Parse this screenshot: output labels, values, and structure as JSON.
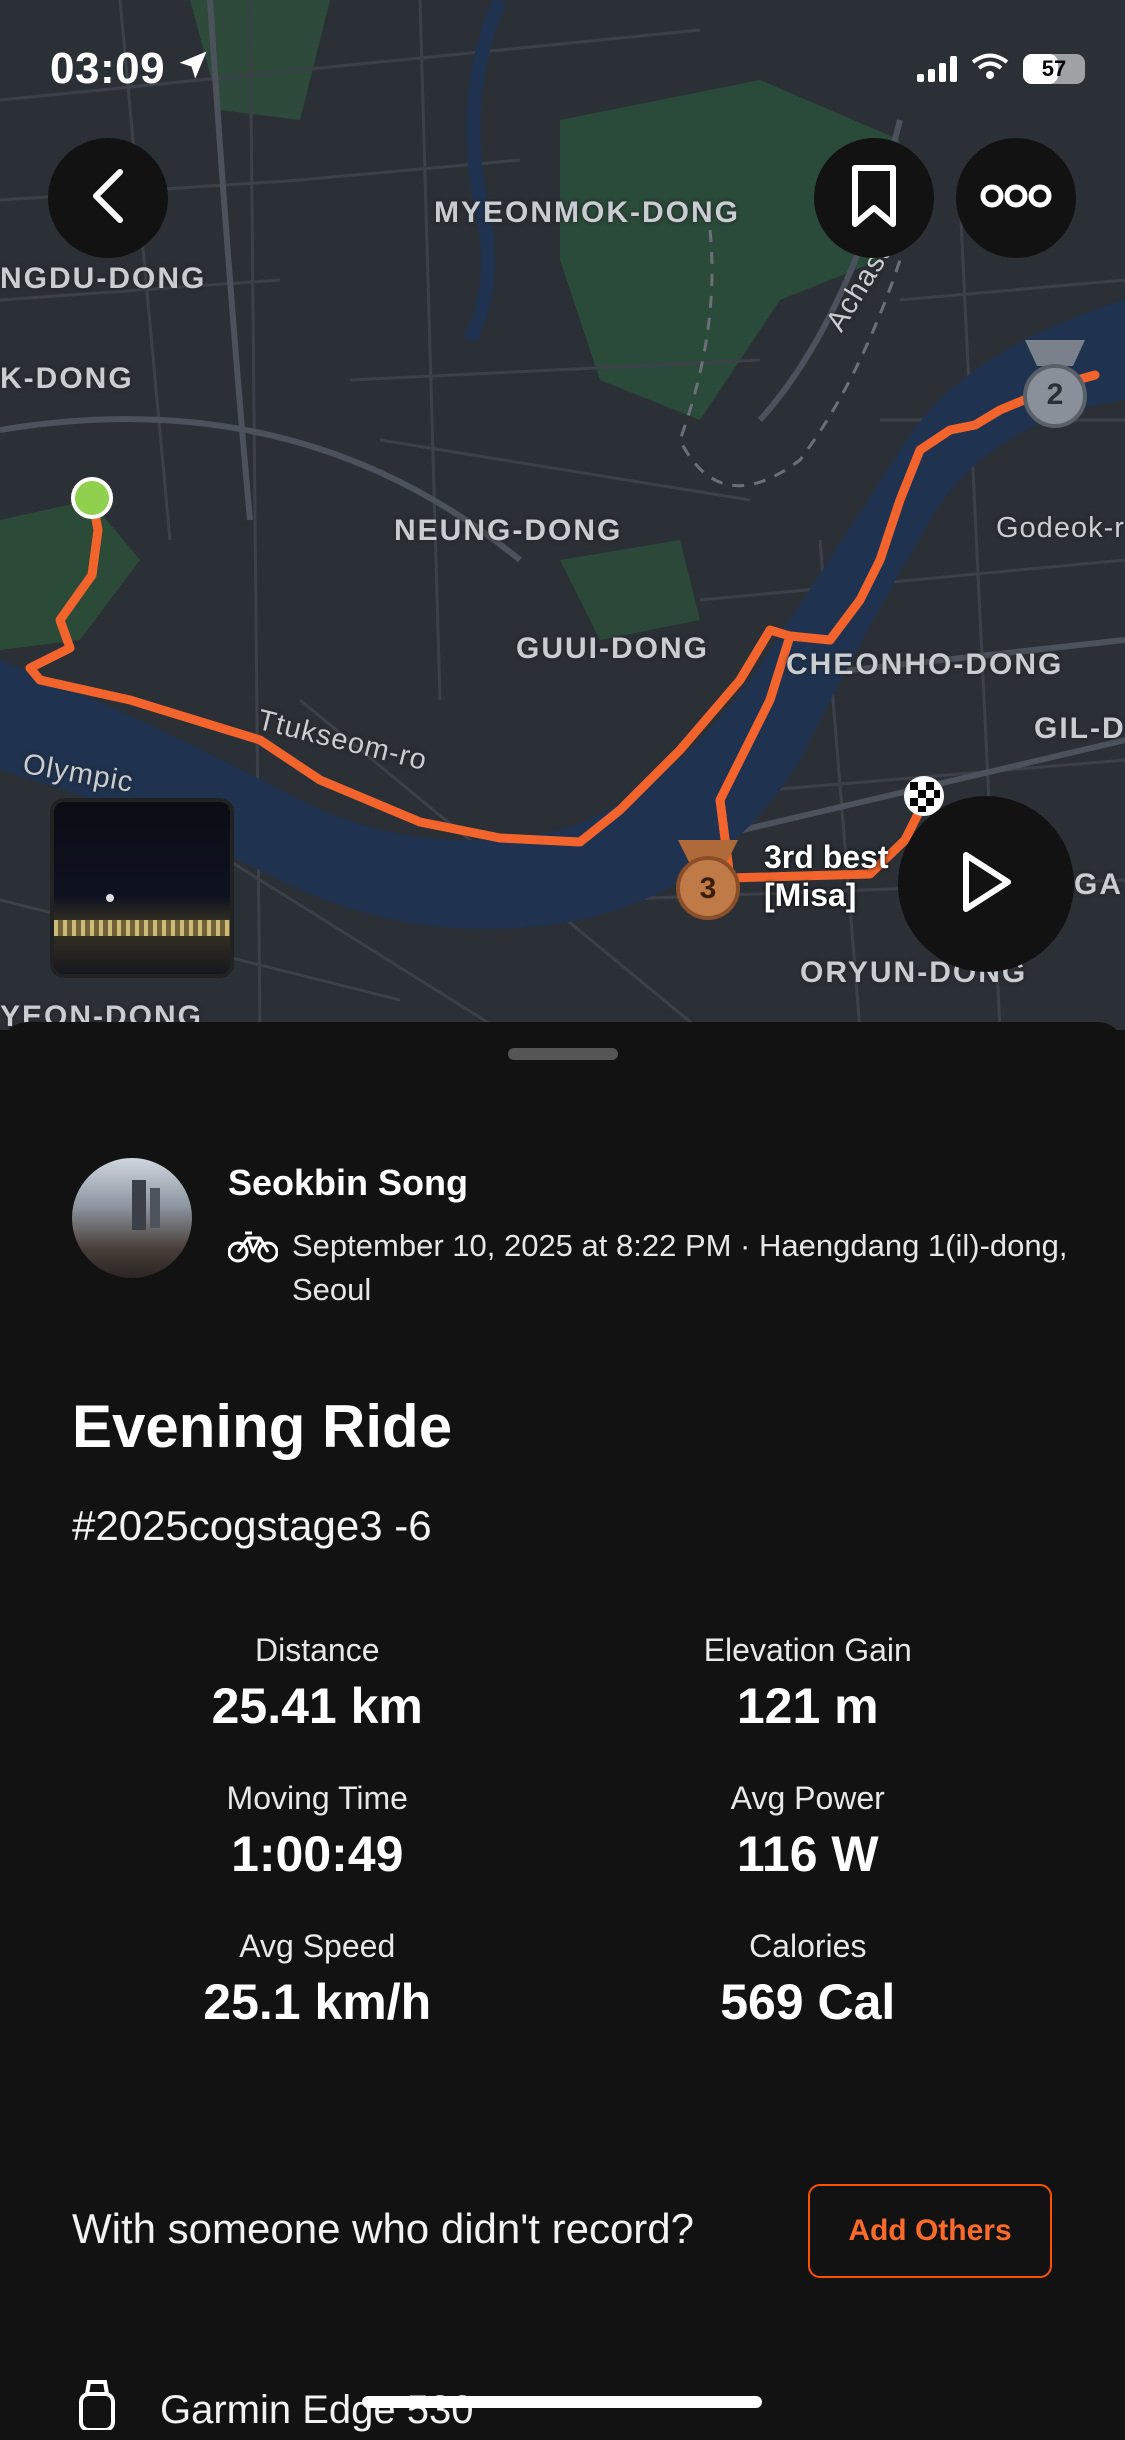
{
  "status_bar": {
    "time": "03:09",
    "battery": "57"
  },
  "map": {
    "labels": [
      "MYEONMOK-DONG",
      "NGDU-DONG",
      "K-DONG",
      "NEUNG-DONG",
      "GUUI-DONG",
      "CHEONHO-DONG",
      "GIL-D",
      "Godeok-r",
      "Achasan-ro",
      "Ttukseom-ro",
      "Olympic",
      "ORYUN-DONG",
      "YEON-DONG",
      "GA"
    ],
    "segment_label_line1": "3rd best",
    "segment_label_line2": "[Misa]",
    "medal_2": "2",
    "medal_3": "3"
  },
  "activity": {
    "user_name": "Seokbin Song",
    "meta": "September 10, 2025 at 8:22 PM · Haengdang 1(il)-dong, Seoul",
    "title": "Evening Ride",
    "description": "#2025cogstage3 -6"
  },
  "stats": [
    {
      "label": "Distance",
      "value": "25.41 km"
    },
    {
      "label": "Elevation Gain",
      "value": "121 m"
    },
    {
      "label": "Moving Time",
      "value": "1:00:49"
    },
    {
      "label": "Avg Power",
      "value": "116 W"
    },
    {
      "label": "Avg Speed",
      "value": "25.1 km/h"
    },
    {
      "label": "Calories",
      "value": "569 Cal"
    }
  ],
  "with_others": {
    "text": "With someone who didn't record?",
    "button": "Add Others"
  },
  "device": {
    "name": "Garmin Edge 530"
  },
  "colors": {
    "accent": "#fc5200",
    "route": "#f2642c",
    "start": "#8fd14f",
    "background": "#121212"
  }
}
